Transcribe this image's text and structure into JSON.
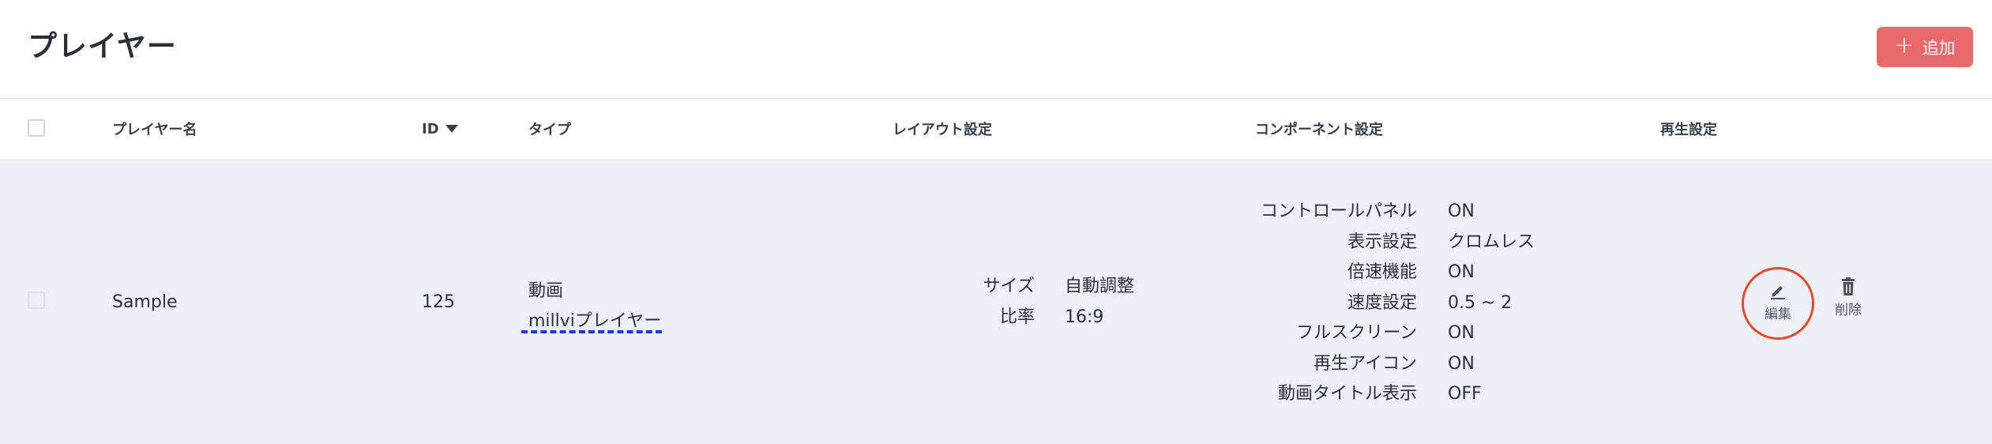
{
  "header": {
    "title": "プレイヤー",
    "add_button_label": "追加"
  },
  "table": {
    "columns": {
      "name": "プレイヤー名",
      "id": "ID",
      "type": "タイプ",
      "layout": "レイアウト設定",
      "component": "コンポーネント設定",
      "playback": "再生設定"
    },
    "rows": [
      {
        "name": "Sample",
        "id": "125",
        "type_line1": "動画",
        "type_line2": "millviプレイヤー",
        "layout": [
          {
            "key": "サイズ",
            "value": "自動調整"
          },
          {
            "key": "比率",
            "value": "16:9"
          }
        ],
        "component": [
          {
            "key": "コントロールパネル",
            "value": "ON"
          },
          {
            "key": "表示設定",
            "value": "クロムレス"
          },
          {
            "key": "倍速機能",
            "value": "ON"
          },
          {
            "key": "速度設定",
            "value": "0.5 ~ 2"
          },
          {
            "key": "フルスクリーン",
            "value": "ON"
          },
          {
            "key": "再生アイコン",
            "value": "ON"
          },
          {
            "key": "動画タイトル表示",
            "value": "OFF"
          }
        ],
        "actions": {
          "edit": "編集",
          "delete": "削除"
        }
      }
    ]
  },
  "colors": {
    "add_button": "#e86a6a",
    "row_background": "#edf0f5",
    "highlight_circle": "#e5492f",
    "dashed_underline": "#2434e0"
  },
  "icons": {
    "add": "plus-icon",
    "sort": "caret-down-icon",
    "edit": "pencil-icon",
    "delete": "trash-icon"
  }
}
